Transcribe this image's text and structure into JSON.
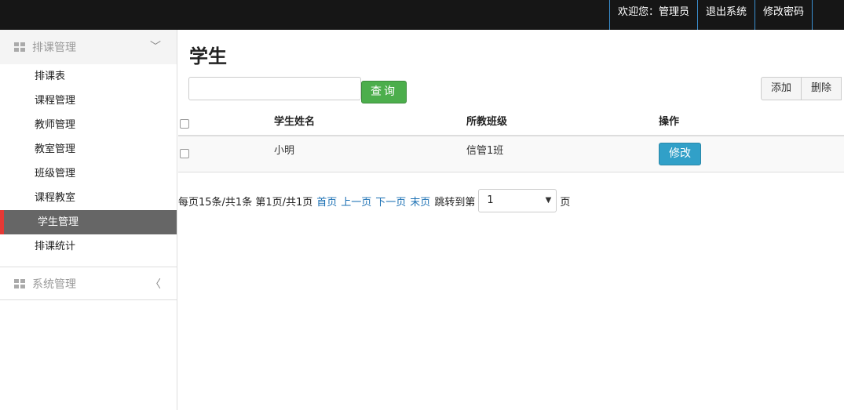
{
  "topnav": {
    "welcome": "欢迎您：管理员",
    "logout": "退出系统",
    "change_password": "修改密码"
  },
  "sidebar": {
    "group1": {
      "title": "排课管理",
      "caret": "﹀"
    },
    "items": [
      "排课表",
      "课程管理",
      "教师管理",
      "教室管理",
      "班级管理",
      "课程教室",
      "学生管理",
      "排课统计"
    ],
    "active_index": 6,
    "group2": {
      "title": "系统管理",
      "caret": "〈"
    }
  },
  "main": {
    "title": "学生",
    "search_placeholder": "",
    "search_button": "查询",
    "add_button": "添加",
    "delete_button": "删除",
    "table": {
      "headers": {
        "name": "学生姓名",
        "class": "所教班级",
        "action": "操作"
      },
      "rows": [
        {
          "name": "小明",
          "class": "信管1班",
          "action": "修改"
        }
      ]
    },
    "pager": {
      "summary": "每页15条/共1条 第1页/共1页",
      "first": "首页",
      "prev": "上一页",
      "next": "下一页",
      "last": "末页",
      "jump_label": "跳转到第",
      "page_value": "1",
      "page_unit": "页"
    }
  },
  "colors": {
    "topbar": "#161616",
    "active_item_bg": "#666666",
    "active_marker": "#e53935",
    "search_button": "#4cae4c",
    "edit_button": "#31a0c8",
    "link": "#1a6fb3"
  }
}
